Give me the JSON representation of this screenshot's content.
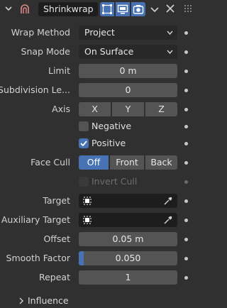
{
  "header": {
    "modifier_name": "Shrinkwrap",
    "icons": [
      "collapse-chevron-icon",
      "shrinkwrap-modifier-icon",
      "edit-mode-icon",
      "viewport-display-icon",
      "render-camera-icon",
      "dropdown-icon",
      "close-icon",
      "drag-grip-icon"
    ]
  },
  "props": {
    "wrap_method": {
      "label": "Wrap Method",
      "value": "Project"
    },
    "snap_mode": {
      "label": "Snap Mode",
      "value": "On Surface"
    },
    "limit": {
      "label": "Limit",
      "value": "0 m"
    },
    "subdivision": {
      "label": "Subdivision Le...",
      "value": "0"
    },
    "axis": {
      "label": "Axis",
      "x": "X",
      "y": "Y",
      "z": "Z"
    },
    "negative": {
      "label": "Negative",
      "checked": false
    },
    "positive": {
      "label": "Positive",
      "checked": true
    },
    "face_cull": {
      "label": "Face Cull",
      "off": "Off",
      "front": "Front",
      "back": "Back",
      "active": "Off"
    },
    "invert_cull": {
      "label": "Invert Cull",
      "checked": false
    },
    "target": {
      "label": "Target",
      "value": ""
    },
    "aux_target": {
      "label": "Auxiliary Target",
      "value": ""
    },
    "offset": {
      "label": "Offset",
      "value": "0.05 m"
    },
    "smooth_factor": {
      "label": "Smooth Factor",
      "value": "0.050",
      "fraction": 0.05
    },
    "repeat": {
      "label": "Repeat",
      "value": "1"
    }
  },
  "influence": {
    "label": "Influence"
  },
  "colors": {
    "accent": "#4772b3",
    "background": "#303030",
    "field": "#545454",
    "dark_field": "#1d1d1d"
  }
}
